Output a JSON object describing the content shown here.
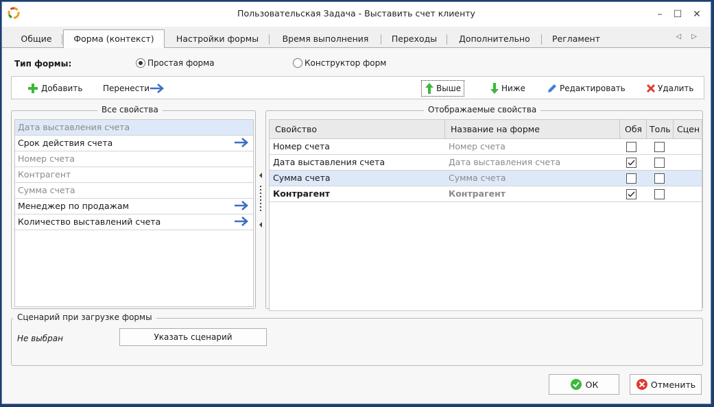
{
  "window": {
    "title": "Пользовательская Задача - Выставить счет клиенту",
    "controls": {
      "minimize": "–",
      "maximize": "☐",
      "close": "✕"
    }
  },
  "tabs": [
    "Общие",
    "Форма (контекст)",
    "Настройки формы",
    "Время выполнения",
    "Переходы",
    "Дополнительно",
    "Регламент"
  ],
  "active_tab": "Форма (контекст)",
  "tab_scroll": "◁ ▷",
  "form_type": {
    "label": "Тип формы:",
    "options": [
      "Простая форма",
      "Конструктор форм"
    ],
    "selected": "Простая форма"
  },
  "toolbar": {
    "add": "Добавить",
    "move": "Перенести",
    "up": "Выше",
    "down": "Ниже",
    "edit": "Редактировать",
    "delete": "Удалить"
  },
  "all_properties": {
    "caption": "Все свойства",
    "items": [
      {
        "label": "Дата выставления счета",
        "grey": true,
        "arrow": false
      },
      {
        "label": "Срок действия счета",
        "grey": false,
        "arrow": true
      },
      {
        "label": "Номер счета",
        "grey": true,
        "arrow": false
      },
      {
        "label": "Контрагент",
        "grey": true,
        "arrow": false
      },
      {
        "label": "Сумма счета",
        "grey": true,
        "arrow": false
      },
      {
        "label": "Менеджер по продажам",
        "grey": false,
        "arrow": true
      },
      {
        "label": "Количество выставлений счета",
        "grey": false,
        "arrow": true
      }
    ]
  },
  "displayed_properties": {
    "caption": "Отображаемые свойства",
    "columns": [
      "Свойство",
      "Название на форме",
      "Обя",
      "Толь",
      "Сцен"
    ],
    "rows": [
      {
        "property": "Номер счета",
        "form_name": "Номер счета",
        "required": false,
        "readonly": false,
        "bold": false
      },
      {
        "property": "Дата выставления счета",
        "form_name": "Дата выставления счета",
        "required": true,
        "readonly": false,
        "bold": false
      },
      {
        "property": "Сумма счета",
        "form_name": "Сумма счета",
        "required": false,
        "readonly": false,
        "bold": false
      },
      {
        "property": "Контрагент",
        "form_name": "Контрагент",
        "required": true,
        "readonly": false,
        "bold": true
      }
    ]
  },
  "script": {
    "caption": "Сценарий при загрузке формы",
    "value": "Не выбран",
    "button": "Указать сценарий"
  },
  "buttons": {
    "ok": "ОК",
    "cancel": "Отменить"
  },
  "colors": {
    "selection": "#dde9f8",
    "arrow": "#3c6fc2",
    "green": "#3cb83a",
    "red": "#e03a2e"
  }
}
